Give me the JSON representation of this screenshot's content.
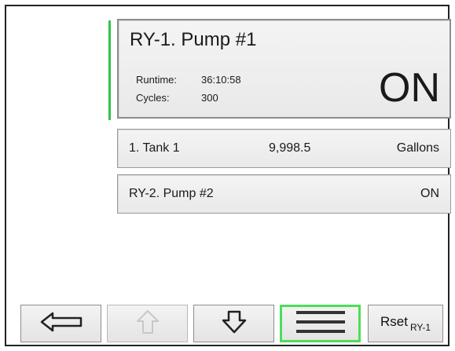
{
  "relays": {
    "primary": {
      "title": "RY-1. Pump #1",
      "runtime_label": "Runtime:",
      "runtime_value": "36:10:58",
      "cycles_label": "Cycles:",
      "cycles_value": "300",
      "state": "ON",
      "active_color": "#34c24a"
    },
    "secondary": {
      "title": "RY-2. Pump #2",
      "state": "ON"
    }
  },
  "tank": {
    "name": "1. Tank 1",
    "value": "9,998.5",
    "unit": "Gallons"
  },
  "toolbar": {
    "back_icon": "arrow-left-icon",
    "up_icon": "arrow-up-icon",
    "down_icon": "arrow-down-icon",
    "menu_icon": "hamburger-menu-icon",
    "rset_label": "Rset",
    "rset_target": "RY-1",
    "menu_highlight_color": "#4ddd59"
  }
}
